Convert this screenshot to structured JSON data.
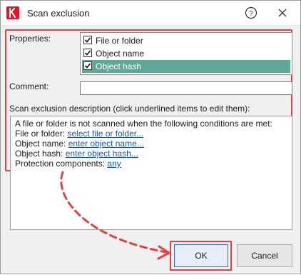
{
  "window": {
    "title": "Scan exclusion",
    "app_logo": "kaspersky-logo",
    "help_icon": "question-circle-icon",
    "close_icon": "close-icon"
  },
  "properties": {
    "label": "Properties:",
    "items": [
      {
        "label": "File or folder",
        "checked": true,
        "selected": false
      },
      {
        "label": "Object name",
        "checked": true,
        "selected": false
      },
      {
        "label": "Object hash",
        "checked": true,
        "selected": true
      }
    ]
  },
  "comment": {
    "label": "Comment:",
    "value": ""
  },
  "description": {
    "label": "Scan exclusion description (click underlined items to edit them):",
    "intro": "A file or folder is not scanned when the following conditions are met:",
    "rows": [
      {
        "key": "File or folder:",
        "link": "select file or folder..."
      },
      {
        "key": "Object name:",
        "link": "enter object name..."
      },
      {
        "key": "Object hash:",
        "link": "enter object hash..."
      },
      {
        "key": "Protection components:",
        "link": "any"
      }
    ]
  },
  "buttons": {
    "ok": "OK",
    "cancel": "Cancel"
  },
  "colors": {
    "highlight": "#e04346",
    "selection": "#5fa898",
    "link": "#1a56b6"
  }
}
